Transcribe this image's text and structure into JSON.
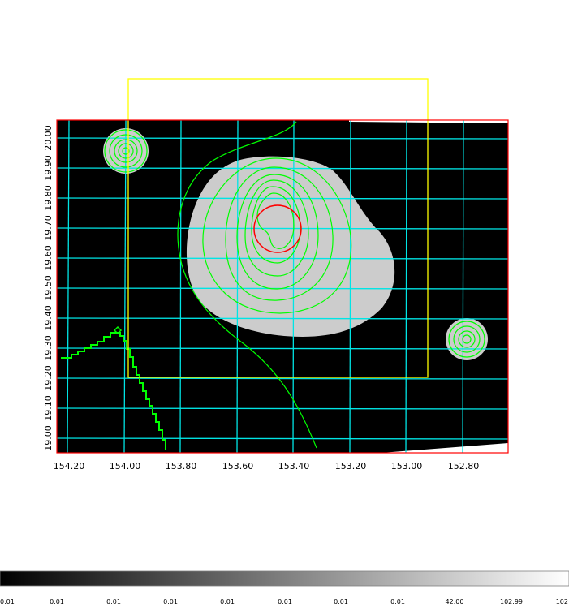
{
  "chart_data": {
    "type": "heatmap",
    "x_axis": {
      "ticks": [
        "154.20",
        "154.00",
        "153.80",
        "153.60",
        "153.40",
        "153.20",
        "153.00",
        "152.80"
      ],
      "values": [
        154.2,
        154.0,
        153.8,
        153.6,
        153.4,
        153.2,
        153.0,
        152.8
      ],
      "direction": "decreasing-right"
    },
    "y_axis": {
      "ticks": [
        "19.00",
        "19.10",
        "19.20",
        "19.30",
        "19.40",
        "19.50",
        "19.60",
        "19.70",
        "19.80",
        "19.90",
        "20.00"
      ],
      "values": [
        19.0,
        19.1,
        19.2,
        19.3,
        19.4,
        19.5,
        19.6,
        19.7,
        19.8,
        19.9,
        20.0
      ],
      "orientation": "rotated-vertical"
    },
    "colorbar": {
      "labels": [
        "0.01",
        "0.01",
        "0.01",
        "0.01",
        "0.01",
        "0.01",
        "0.01",
        "0.01",
        "42.00",
        "102.99",
        "102"
      ],
      "gradient": [
        "#000000",
        "#ffffff"
      ]
    },
    "grid": true,
    "colors": {
      "background_image": "#000000",
      "source_fill": "#cccccc",
      "grid": "#00e5e5",
      "contours": "#00ff00",
      "frame": "#ff0000",
      "circle_region": "#ff0000",
      "box_region": "#ffff00"
    },
    "regions": [
      {
        "shape": "circle",
        "color": "red",
        "center": [
          153.43,
          19.69
        ],
        "radius_deg": 0.054
      },
      {
        "shape": "box",
        "color": "yellow",
        "ra_range": [
          152.93,
          153.95
        ],
        "dec_range": [
          19.2,
          20.11
        ]
      }
    ]
  }
}
